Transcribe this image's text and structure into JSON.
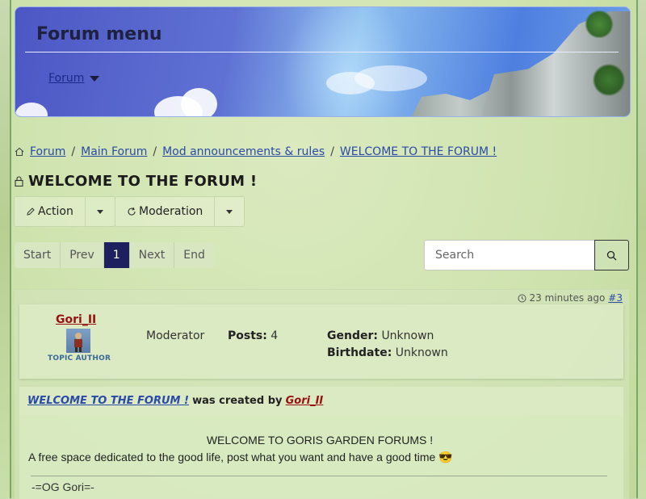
{
  "header": {
    "menu_title": "Forum menu",
    "forum_link": "Forum"
  },
  "breadcrumb": {
    "items": [
      "Forum",
      "Main Forum",
      "Mod announcements & rules",
      "WELCOME TO THE FORUM !"
    ],
    "separator": "/"
  },
  "topic": {
    "title": "WELCOME TO THE FORUM !"
  },
  "toolbar": {
    "action_label": "Action",
    "moderation_label": "Moderation"
  },
  "pagination": {
    "start": "Start",
    "prev": "Prev",
    "current": "1",
    "next": "Next",
    "end": "End"
  },
  "search": {
    "placeholder": "Search"
  },
  "post": {
    "time_ago": "23 minutes ago",
    "post_number": "#3",
    "author": {
      "name": "Gori_II",
      "tag": "TOPIC AUTHOR",
      "role": "Moderator",
      "posts_label": "Posts:",
      "posts_value": "4",
      "gender_label": "Gender:",
      "gender_value": "Unknown",
      "birthdate_label": "Birthdate:",
      "birthdate_value": "Unknown"
    },
    "created": {
      "topic": "WELCOME TO THE FORUM !",
      "middle": "was created by",
      "user": "Gori_II"
    },
    "body": {
      "line1": "WELCOME TO GORIS GARDEN FORUMS !",
      "line2": "A free space dedicated to the good life, post what you want and have a good time 😎",
      "signature": "-=OG Gori=-"
    }
  },
  "colors": {
    "accent_dark": "#1d1f5e",
    "link": "#2a4aa8",
    "username": "#9a1010"
  }
}
